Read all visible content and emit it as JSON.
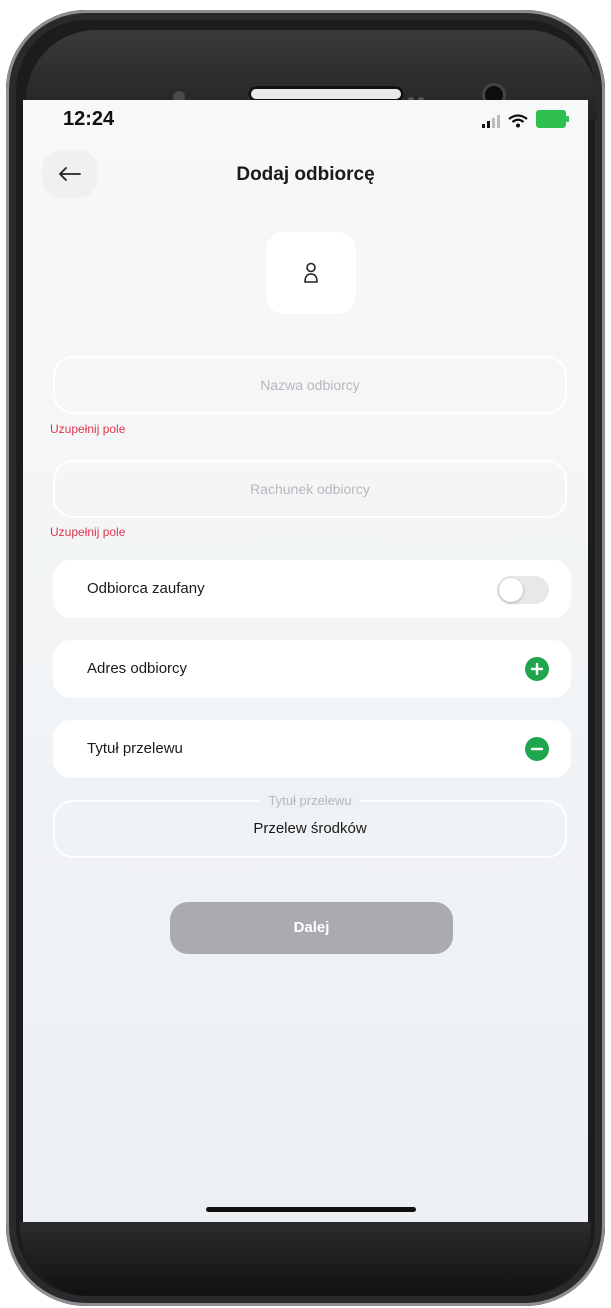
{
  "status_bar": {
    "time": "12:24"
  },
  "header": {
    "title": "Dodaj odbiorcę",
    "back_icon": "arrow-left-icon"
  },
  "avatar": {
    "icon": "person-icon"
  },
  "form": {
    "recipient_name": {
      "placeholder": "Nazwa odbiorcy",
      "value": "",
      "error": "Uzupełnij pole"
    },
    "recipient_account": {
      "placeholder": "Rachunek odbiorcy",
      "value": "",
      "error": "Uzupełnij pole"
    },
    "trusted_recipient": {
      "label": "Odbiorca zaufany",
      "enabled": false
    },
    "recipient_address": {
      "label": "Adres odbiorcy",
      "icon": "plus-circle-icon"
    },
    "transfer_title_section": {
      "label": "Tytuł przelewu",
      "icon": "minus-circle-icon"
    },
    "transfer_title_field": {
      "label": "Tytuł przelewu",
      "value": "Przelew środków"
    }
  },
  "actions": {
    "next_label": "Dalej"
  },
  "colors": {
    "accent_green": "#1fa54c",
    "error_red": "#e0374c",
    "disabled_button": "#a9abae"
  }
}
